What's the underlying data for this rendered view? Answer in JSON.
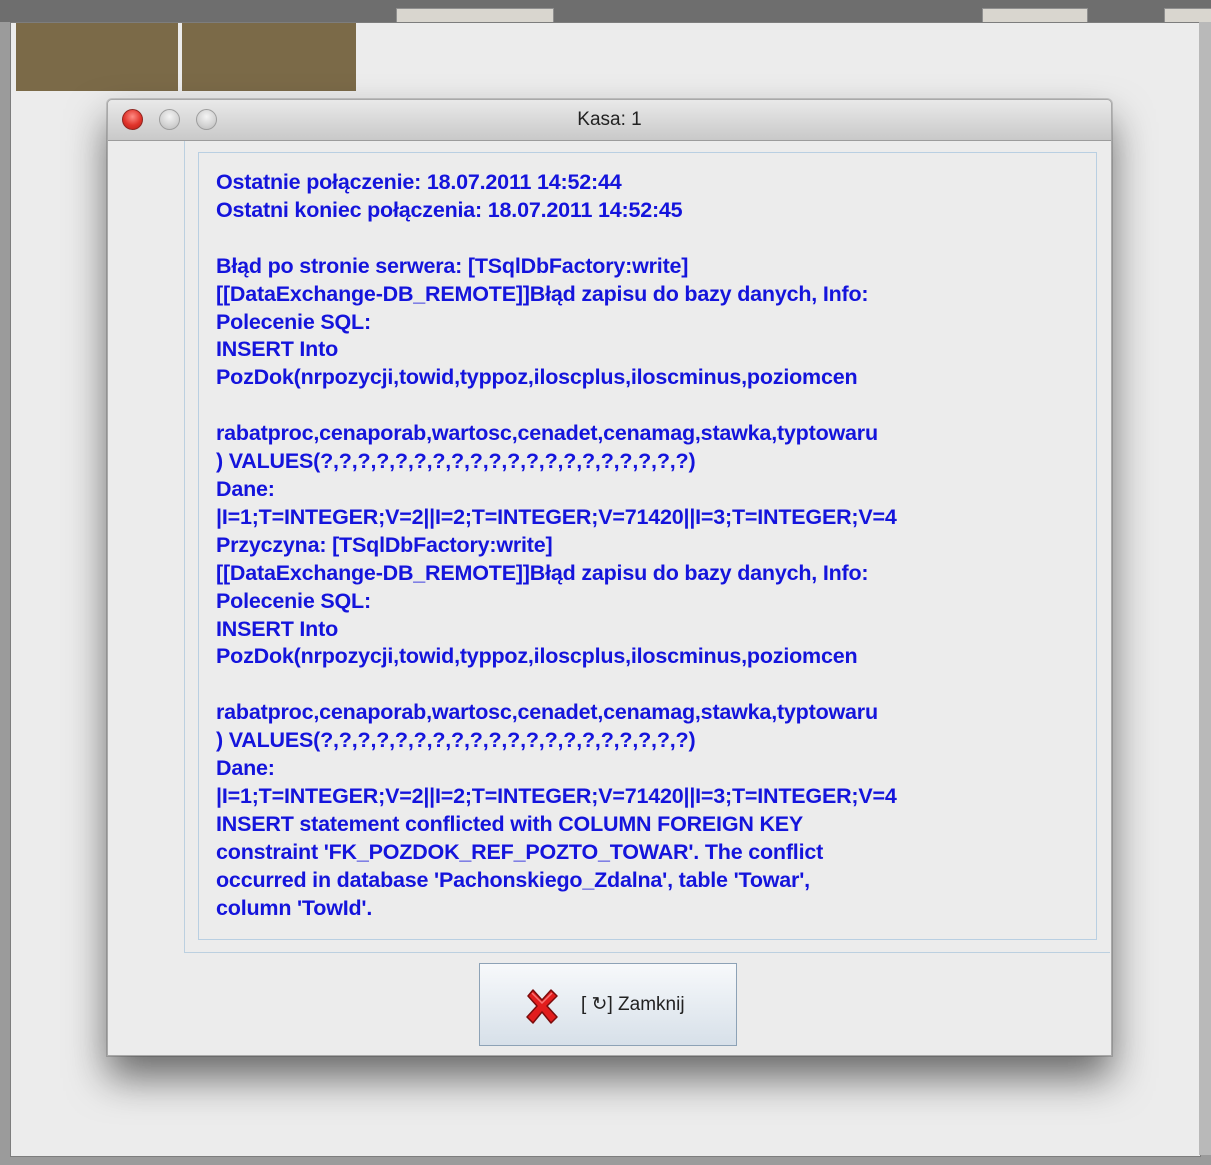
{
  "dialog": {
    "title": "Kasa: 1",
    "message_lines": [
      "Ostatnie połączenie: 18.07.2011 14:52:44",
      "Ostatni koniec połączenia: 18.07.2011 14:52:45",
      "",
      "Błąd po stronie serwera: [TSqlDbFactory:write]",
      "[[DataExchange-DB_REMOTE]]Błąd zapisu do bazy danych, Info:",
      "Polecenie SQL:",
      "INSERT Into",
      "PozDok(nrpozycji,towid,typpoz,iloscplus,iloscminus,poziomcen",
      "",
      "rabatproc,cenaporab,wartosc,cenadet,cenamag,stawka,typtowaru",
      ") VALUES(?,?,?,?,?,?,?,?,?,?,?,?,?,?,?,?,?,?,?,?)",
      "Dane:",
      "|I=1;T=INTEGER;V=2||I=2;T=INTEGER;V=71420||I=3;T=INTEGER;V=4",
      "Przyczyna: [TSqlDbFactory:write]",
      "[[DataExchange-DB_REMOTE]]Błąd zapisu do bazy danych, Info:",
      "Polecenie SQL:",
      "INSERT Into",
      "PozDok(nrpozycji,towid,typpoz,iloscplus,iloscminus,poziomcen",
      "",
      "rabatproc,cenaporab,wartosc,cenadet,cenamag,stawka,typtowaru",
      ") VALUES(?,?,?,?,?,?,?,?,?,?,?,?,?,?,?,?,?,?,?,?)",
      "Dane:",
      "|I=1;T=INTEGER;V=2||I=2;T=INTEGER;V=71420||I=3;T=INTEGER;V=4",
      "INSERT statement conflicted with COLUMN FOREIGN KEY",
      "constraint 'FK_POZDOK_REF_POZTO_TOWAR'. The conflict",
      "occurred in database 'Pachonskiego_Zdalna', table 'Towar',",
      "column 'TowId'."
    ],
    "close_button_label": "[ ↻] Zamknij",
    "close_icon": "red-x-icon"
  },
  "colors": {
    "message_text": "#1414dc",
    "background_tile": "#7b6a48"
  }
}
